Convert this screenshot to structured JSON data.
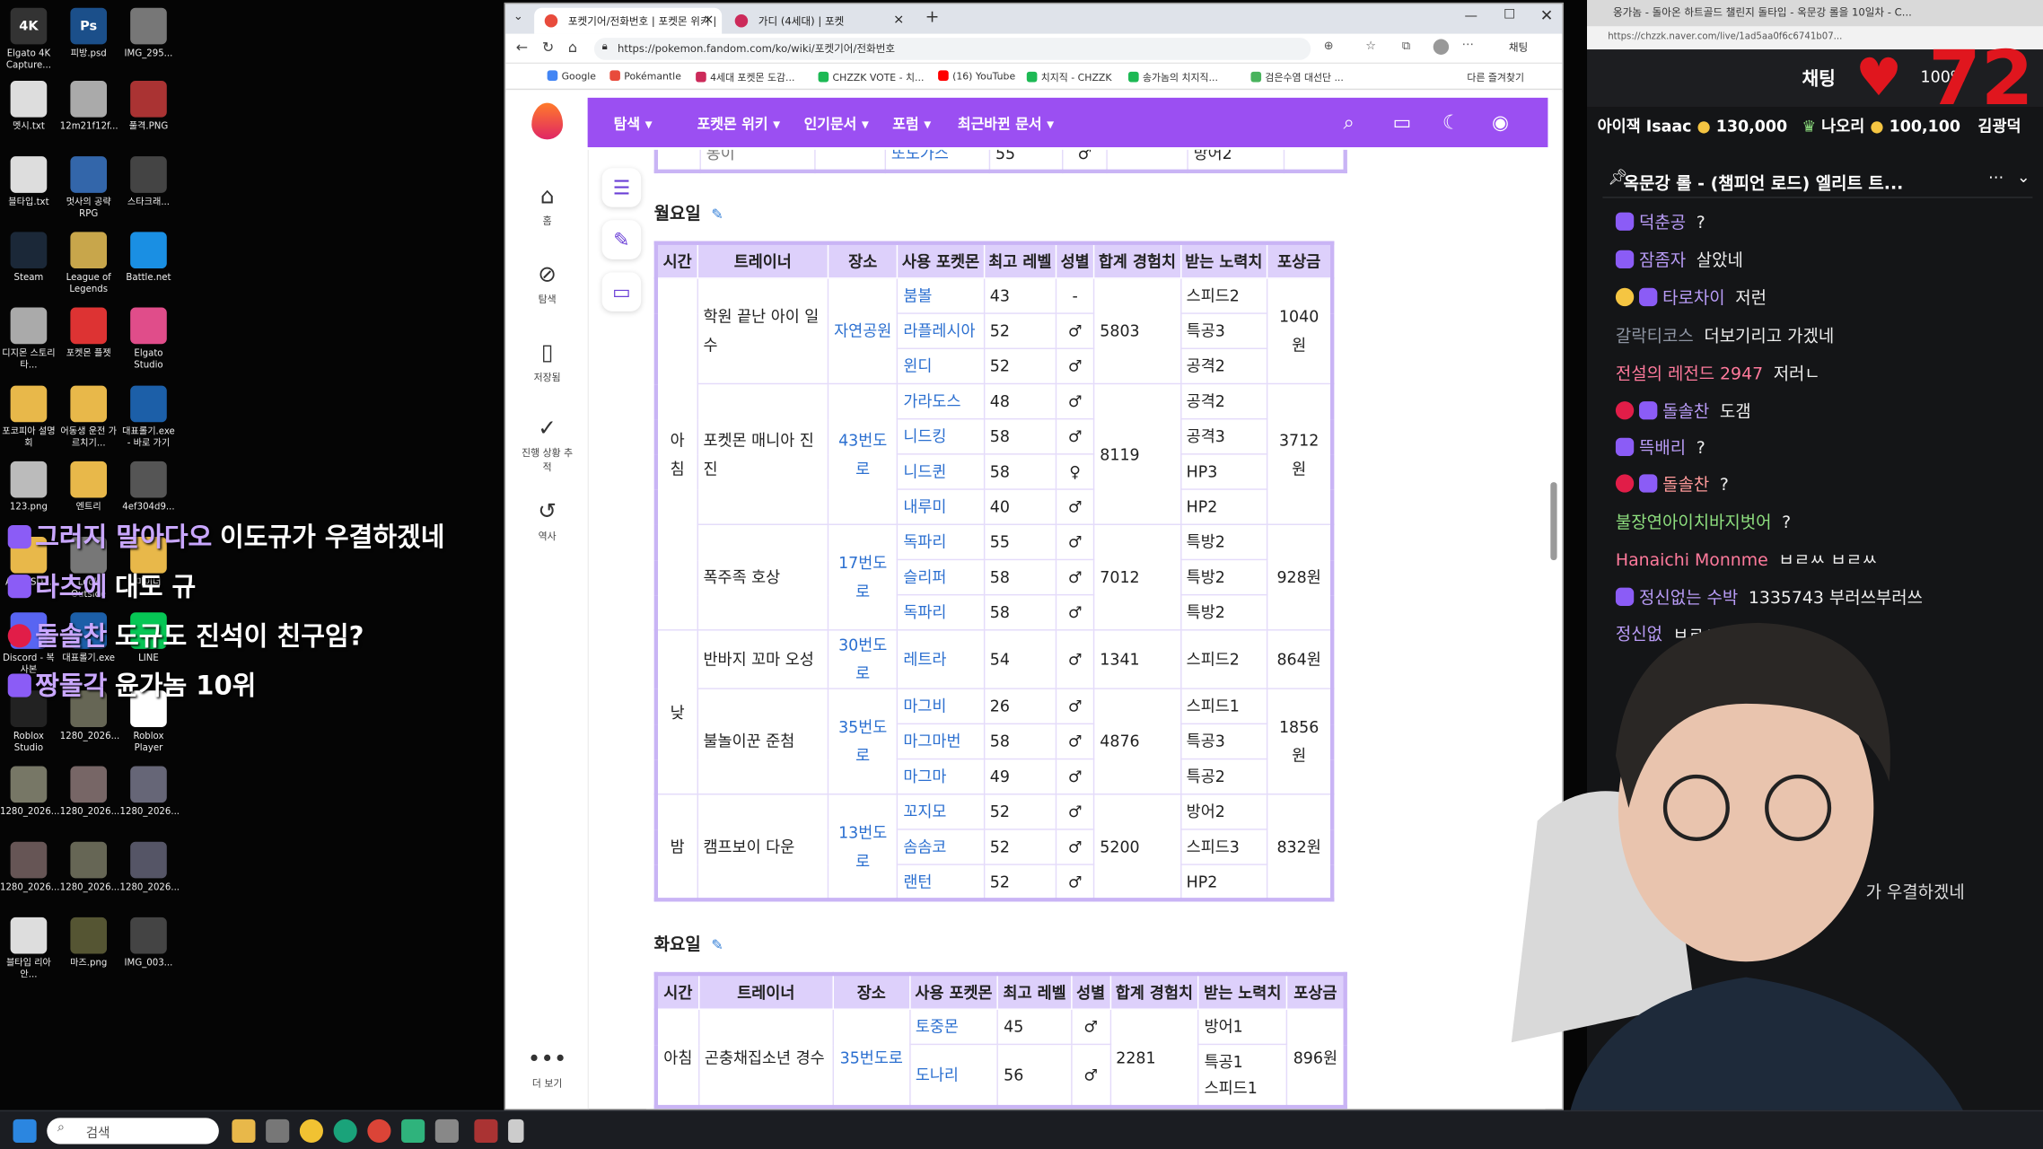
{
  "desktop": {
    "icons": [
      {
        "label": "Elgato 4K Capture...",
        "glyph": "4K",
        "color": "#333"
      },
      {
        "label": "피방.psd",
        "glyph": "Ps",
        "color": "#1b4f8a"
      },
      {
        "label": "IMG_295...",
        "glyph": "",
        "color": "#777"
      },
      {
        "label": "멧시.txt",
        "glyph": "",
        "color": "#ddd"
      },
      {
        "label": "12m21f12f...",
        "glyph": "",
        "color": "#aaa"
      },
      {
        "label": "풀격.PNG",
        "glyph": "",
        "color": "#a33"
      },
      {
        "label": "블타입.txt",
        "glyph": "",
        "color": "#ddd"
      },
      {
        "label": "멋사의 공략 RPG",
        "glyph": "",
        "color": "#36a"
      },
      {
        "label": "스타크래...",
        "glyph": "",
        "color": "#444"
      },
      {
        "label": "Steam",
        "glyph": "",
        "color": "#1b2838"
      },
      {
        "label": "League of Legends",
        "glyph": "",
        "color": "#c8a64b"
      },
      {
        "label": "Battle.net",
        "glyph": "",
        "color": "#1a8fe3"
      },
      {
        "label": "디지몬 스토리 타...",
        "glyph": "",
        "color": "#aaa"
      },
      {
        "label": "포켓몬 플젯",
        "glyph": "",
        "color": "#d33"
      },
      {
        "label": "Elgato Studio",
        "glyph": "",
        "color": "#e04d8a"
      },
      {
        "label": "포코피아 설명회",
        "glyph": "",
        "color": "#e8b84a"
      },
      {
        "label": "어동생 운전 가르치기...",
        "glyph": "",
        "color": "#e8b84a"
      },
      {
        "label": "대표롤기.exe - 바로 가기",
        "glyph": "",
        "color": "#1c5fa8"
      },
      {
        "label": "123.png",
        "glyph": "",
        "color": "#bbb"
      },
      {
        "label": "엔트리",
        "glyph": "",
        "color": "#e8b84a"
      },
      {
        "label": "4ef304d9...",
        "glyph": "",
        "color": "#555"
      },
      {
        "label": "ASDASD...",
        "glyph": "",
        "color": "#e8b84a"
      },
      {
        "label": "Look Outside",
        "glyph": "",
        "color": "#777"
      },
      {
        "label": "마이너",
        "glyph": "",
        "color": "#e8b84a"
      },
      {
        "label": "Discord - 복사본",
        "glyph": "",
        "color": "#5865f2"
      },
      {
        "label": "대표롤기.exe",
        "glyph": "",
        "color": "#1c5fa8"
      },
      {
        "label": "LINE",
        "glyph": "",
        "color": "#06c755"
      },
      {
        "label": "Roblox Studio",
        "glyph": "",
        "color": "#222"
      },
      {
        "label": "1280_2026...",
        "glyph": "",
        "color": "#665"
      },
      {
        "label": "Roblox Player",
        "glyph": "",
        "color": "#fff"
      },
      {
        "label": "1280_2026...",
        "glyph": "",
        "color": "#776"
      },
      {
        "label": "1280_2026...",
        "glyph": "",
        "color": "#766"
      },
      {
        "label": "1280_2026...",
        "glyph": "",
        "color": "#667"
      },
      {
        "label": "1280_2026...",
        "glyph": "",
        "color": "#655"
      },
      {
        "label": "1280_2026...",
        "glyph": "",
        "color": "#665"
      },
      {
        "label": "1280_2026...",
        "glyph": "",
        "color": "#556"
      },
      {
        "label": "블타입 리아안...",
        "glyph": "",
        "color": "#ddd"
      },
      {
        "label": "마즈.png",
        "glyph": "",
        "color": "#553"
      },
      {
        "label": "IMG_003...",
        "glyph": "",
        "color": "#444"
      }
    ],
    "overlay_chat": [
      {
        "nick": "그러지 말아다오",
        "text": "이도규가 우결하겠네"
      },
      {
        "nick": "라츠에",
        "text": "대도 규"
      },
      {
        "nick": "돌솔찬",
        "text": "도규도 진석이 친구임?"
      },
      {
        "nick": "짱돌각",
        "text": "윤가놈 10위"
      }
    ]
  },
  "taskbar": {
    "search_placeholder": "검색"
  },
  "browser": {
    "tabs": [
      {
        "title": "포켓기어/전화번호 | 포켓몬 위키 |"
      },
      {
        "title": "가디 (4세대) | 포켓"
      }
    ],
    "url": "https://pokemon.fandom.com/ko/wiki/포켓기어/전화번호",
    "bookmarks": [
      "Google",
      "Pokémantle",
      "4세대 포켓몬 도감...",
      "CHZZK VOTE - 치...",
      "(16) YouTube",
      "치지직 - CHZZK",
      "송가놈의 치지직...",
      "검은수염 대선단 ..."
    ],
    "other_bookmarks": "다른 즐겨찾기",
    "chat_button": "채팅"
  },
  "site": {
    "nav": [
      "탐색",
      "포켓몬 위키",
      "인기문서",
      "포럼",
      "최근바뀐 문서"
    ],
    "rail": [
      "홈",
      "탐색",
      "저장됨",
      "진행 상황 추적",
      "역사",
      "더 보기"
    ],
    "partial_row": {
      "place": "",
      "pokemon": "또도가스",
      "level": "55",
      "gender": "♂",
      "ev": "방어2",
      "top_cut": "동이"
    },
    "monday": {
      "title": "월요일",
      "headers": [
        "시간",
        "트레이너",
        "장소",
        "사용 포켓몬",
        "최고 레벨",
        "성별",
        "합계 경험치",
        "받는 노력치",
        "포상금"
      ],
      "groups": [
        {
          "time": "아침",
          "trainers": [
            {
              "name": "학원 끝난 아이 일수",
              "place": "자연공원",
              "exp": "5803",
              "money": "1040원",
              "mons": [
                [
                  "붐볼",
                  "43",
                  "-",
                  "스피드2"
                ],
                [
                  "라플레시아",
                  "52",
                  "♂",
                  "특공3"
                ],
                [
                  "윈디",
                  "52",
                  "♂",
                  "공격2"
                ]
              ]
            },
            {
              "name": "포켓몬 매니아 진진",
              "place": "43번도로",
              "exp": "8119",
              "money": "3712원",
              "mons": [
                [
                  "가라도스",
                  "48",
                  "♂",
                  "공격2"
                ],
                [
                  "니드킹",
                  "58",
                  "♂",
                  "공격3"
                ],
                [
                  "니드퀸",
                  "58",
                  "♀",
                  "HP3"
                ],
                [
                  "내루미",
                  "40",
                  "♂",
                  "HP2"
                ]
              ]
            },
            {
              "name": "폭주족 호상",
              "place": "17번도로",
              "exp": "7012",
              "money": "928원",
              "mons": [
                [
                  "독파리",
                  "55",
                  "♂",
                  "특방2"
                ],
                [
                  "슬리퍼",
                  "58",
                  "♂",
                  "특방2"
                ],
                [
                  "독파리",
                  "58",
                  "♂",
                  "특방2"
                ]
              ]
            }
          ]
        },
        {
          "time": "낮",
          "trainers": [
            {
              "name": "반바지 꼬마 오성",
              "place": "30번도로",
              "exp": "1341",
              "money": "864원",
              "mons": [
                [
                  "레트라",
                  "54",
                  "♂",
                  "스피드2"
                ]
              ]
            },
            {
              "name": "불놀이꾼 준첨",
              "place": "35번도로",
              "exp": "4876",
              "money": "1856원",
              "mons": [
                [
                  "마그비",
                  "26",
                  "♂",
                  "스피드1"
                ],
                [
                  "마그마번",
                  "58",
                  "♂",
                  "특공3"
                ],
                [
                  "마그마",
                  "49",
                  "♂",
                  "특공2"
                ]
              ]
            }
          ]
        },
        {
          "time": "밤",
          "trainers": [
            {
              "name": "캠프보이 다운",
              "place": "13번도로",
              "exp": "5200",
              "money": "832원",
              "mons": [
                [
                  "꼬지모",
                  "52",
                  "♂",
                  "방어2"
                ],
                [
                  "솜솜코",
                  "52",
                  "♂",
                  "스피드3"
                ],
                [
                  "랜턴",
                  "52",
                  "♂",
                  "HP2"
                ]
              ]
            }
          ]
        }
      ]
    },
    "tuesday": {
      "title": "화요일",
      "headers": [
        "시간",
        "트레이너",
        "장소",
        "사용 포켓몬",
        "최고 레벨",
        "성별",
        "합계 경험치",
        "받는 노력치",
        "포상금"
      ],
      "time": "아침",
      "trainer": "곤충채집소년 경수",
      "place": "35번도로",
      "exp": "2281",
      "money": "896원",
      "mons": [
        [
          "토중몬",
          "45",
          "♂",
          "방어1"
        ],
        [
          "도나리",
          "56",
          "♂",
          "특공1\n스피드1"
        ]
      ]
    }
  },
  "stream": {
    "title": "옹가놈 - 돌아온 하트골드 챌린지 돌타입 - 옥문강 롤을 10일차 - C...",
    "url": "https://chzzk.naver.com/live/1ad5aa0f6c6741b07...",
    "header_label": "채팅",
    "zoom": "100%",
    "viewer_count_big": "72",
    "donors": [
      {
        "name": "아이잭 Isaac",
        "amount": "130,000"
      },
      {
        "name": "나오리",
        "amount": "100,100"
      },
      {
        "name": "김광덕",
        "amount": ""
      }
    ],
    "pinned": "옥문강 롤 - (챔피언 로드) 엘리트 트...",
    "messages": [
      {
        "nick": "덕춘공",
        "text": "?",
        "color": "#b99cf7",
        "badge": "b"
      },
      {
        "nick": "잠좀자",
        "text": "살았네",
        "color": "#b99cf7",
        "badge": "b"
      },
      {
        "nick": "타로차이",
        "text": "저런",
        "color": "#b99cf7",
        "badge": "g"
      },
      {
        "nick": "갈락티코스",
        "text": "더보기리고 가겠네",
        "color": "#8e95a3",
        "badge": ""
      },
      {
        "nick": "전설의 레전드 2947",
        "text": "저러ㄴ",
        "color": "#ff7a9c",
        "badge": ""
      },
      {
        "nick": "돌솔찬",
        "text": "도갬",
        "color": "#b99cf7",
        "badge": "r"
      },
      {
        "nick": "뜩배리",
        "text": "?",
        "color": "#b99cf7",
        "badge": "b"
      },
      {
        "nick": "돌솔찬",
        "text": "?",
        "color": "#ff9a9a",
        "badge": "r"
      },
      {
        "nick": "불장연아이치바지벗어",
        "text": "?",
        "color": "#8ee07f",
        "badge": ""
      },
      {
        "nick": "Hanaichi Monnme",
        "text": "ㅂㄹㅆ ㅂㄹㅆ",
        "color": "#ff7a9c",
        "badge": ""
      },
      {
        "nick": "정신없는 수박",
        "text": "1335743 부러쓰부러쓰",
        "color": "#b99cf7",
        "badge": "b"
      },
      {
        "nick": "정신없",
        "text": "ㅂㄹㅆㅂㄹㅆ",
        "color": "#b99cf7",
        "badge": ""
      }
    ],
    "bottom_fragment": "가 우결하겠네"
  }
}
